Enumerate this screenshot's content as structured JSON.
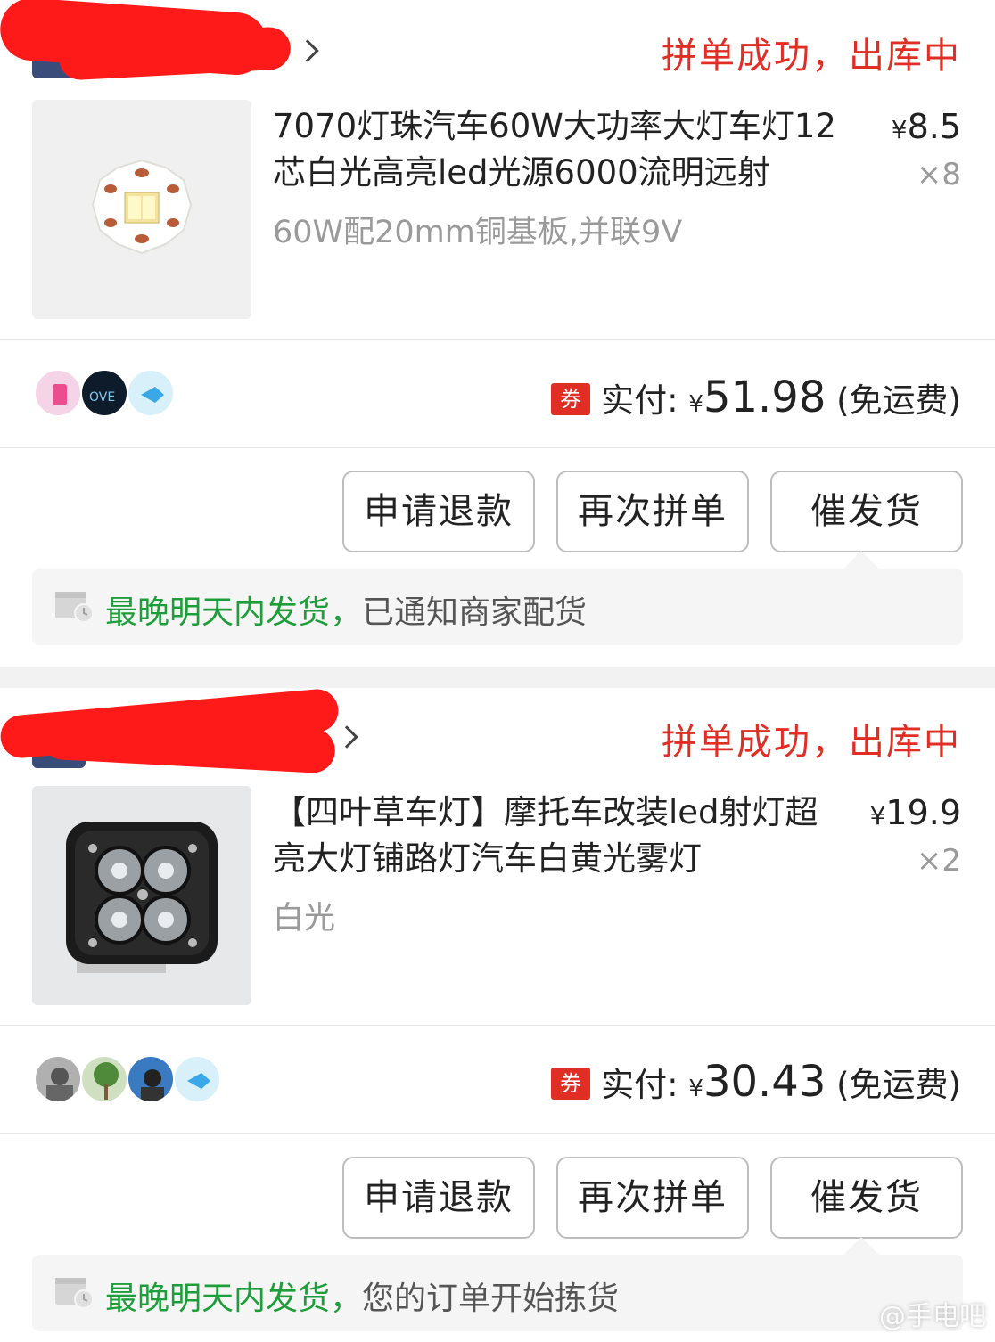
{
  "orders": [
    {
      "status": "拼单成功，出库中",
      "product": {
        "title": "7070灯珠汽车60W大功率大灯车灯12芯白光高亮led光源6000流明远射",
        "spec": "60W配20mm铜基板,并联9V",
        "price_symbol": "¥",
        "price": "8.5",
        "qty": "×8"
      },
      "payment": {
        "coupon": "券",
        "label": "实付:",
        "currency": "¥",
        "amount": "51.98",
        "shipping": "(免运费)"
      },
      "buttons": [
        "申请退款",
        "再次拼单",
        "催发货"
      ],
      "notice": {
        "highlight": "最晚明天内发货，",
        "text": "已通知商家配货"
      }
    },
    {
      "status": "拼单成功，出库中",
      "product": {
        "title": "【四叶草车灯】摩托车改装led射灯超亮大灯铺路灯汽车白黄光雾灯",
        "spec": "白光",
        "price_symbol": "¥",
        "price": "19.9",
        "qty": "×2"
      },
      "payment": {
        "coupon": "券",
        "label": "实付:",
        "currency": "¥",
        "amount": "30.43",
        "shipping": "(免运费)"
      },
      "buttons": [
        "申请退款",
        "再次拼单",
        "催发货"
      ],
      "notice": {
        "highlight": "最晚明天内发货，",
        "text": "您的订单开始拣货"
      }
    }
  ],
  "watermark": "@手电吧",
  "colors": {
    "accent": "#e02e24",
    "green": "#1e9e3a"
  }
}
